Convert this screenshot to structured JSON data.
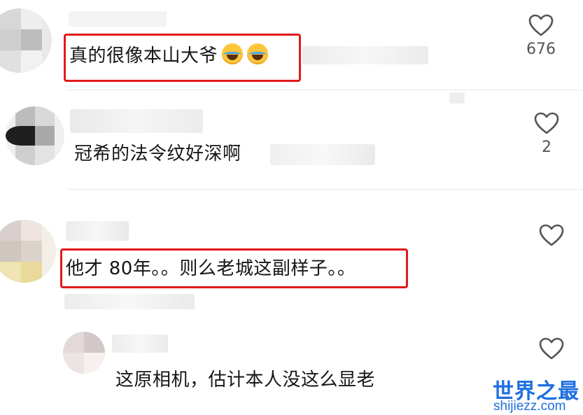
{
  "comments": [
    {
      "text": "真的很像本山大爷",
      "emojis": [
        "laughing-tears-emoji",
        "laughing-tears-emoji"
      ],
      "likes": "676",
      "highlighted": true
    },
    {
      "text": "冠希的法令纹好深啊",
      "emojis": [],
      "likes": "2",
      "highlighted": false
    },
    {
      "text": "他才 80年。。则么老城这副样子。。",
      "emojis": [],
      "likes": "",
      "highlighted": true
    },
    {
      "text": "这原相机，估计本人没这么显老",
      "emojis": [],
      "likes": "",
      "highlighted": false,
      "is_reply": true
    }
  ],
  "watermark": {
    "brand": "世界之最",
    "domain": "shijiezz.com"
  },
  "colors": {
    "highlight_box": "#e2191c",
    "watermark": "#1f6fe0",
    "like_icon": "#555555"
  }
}
